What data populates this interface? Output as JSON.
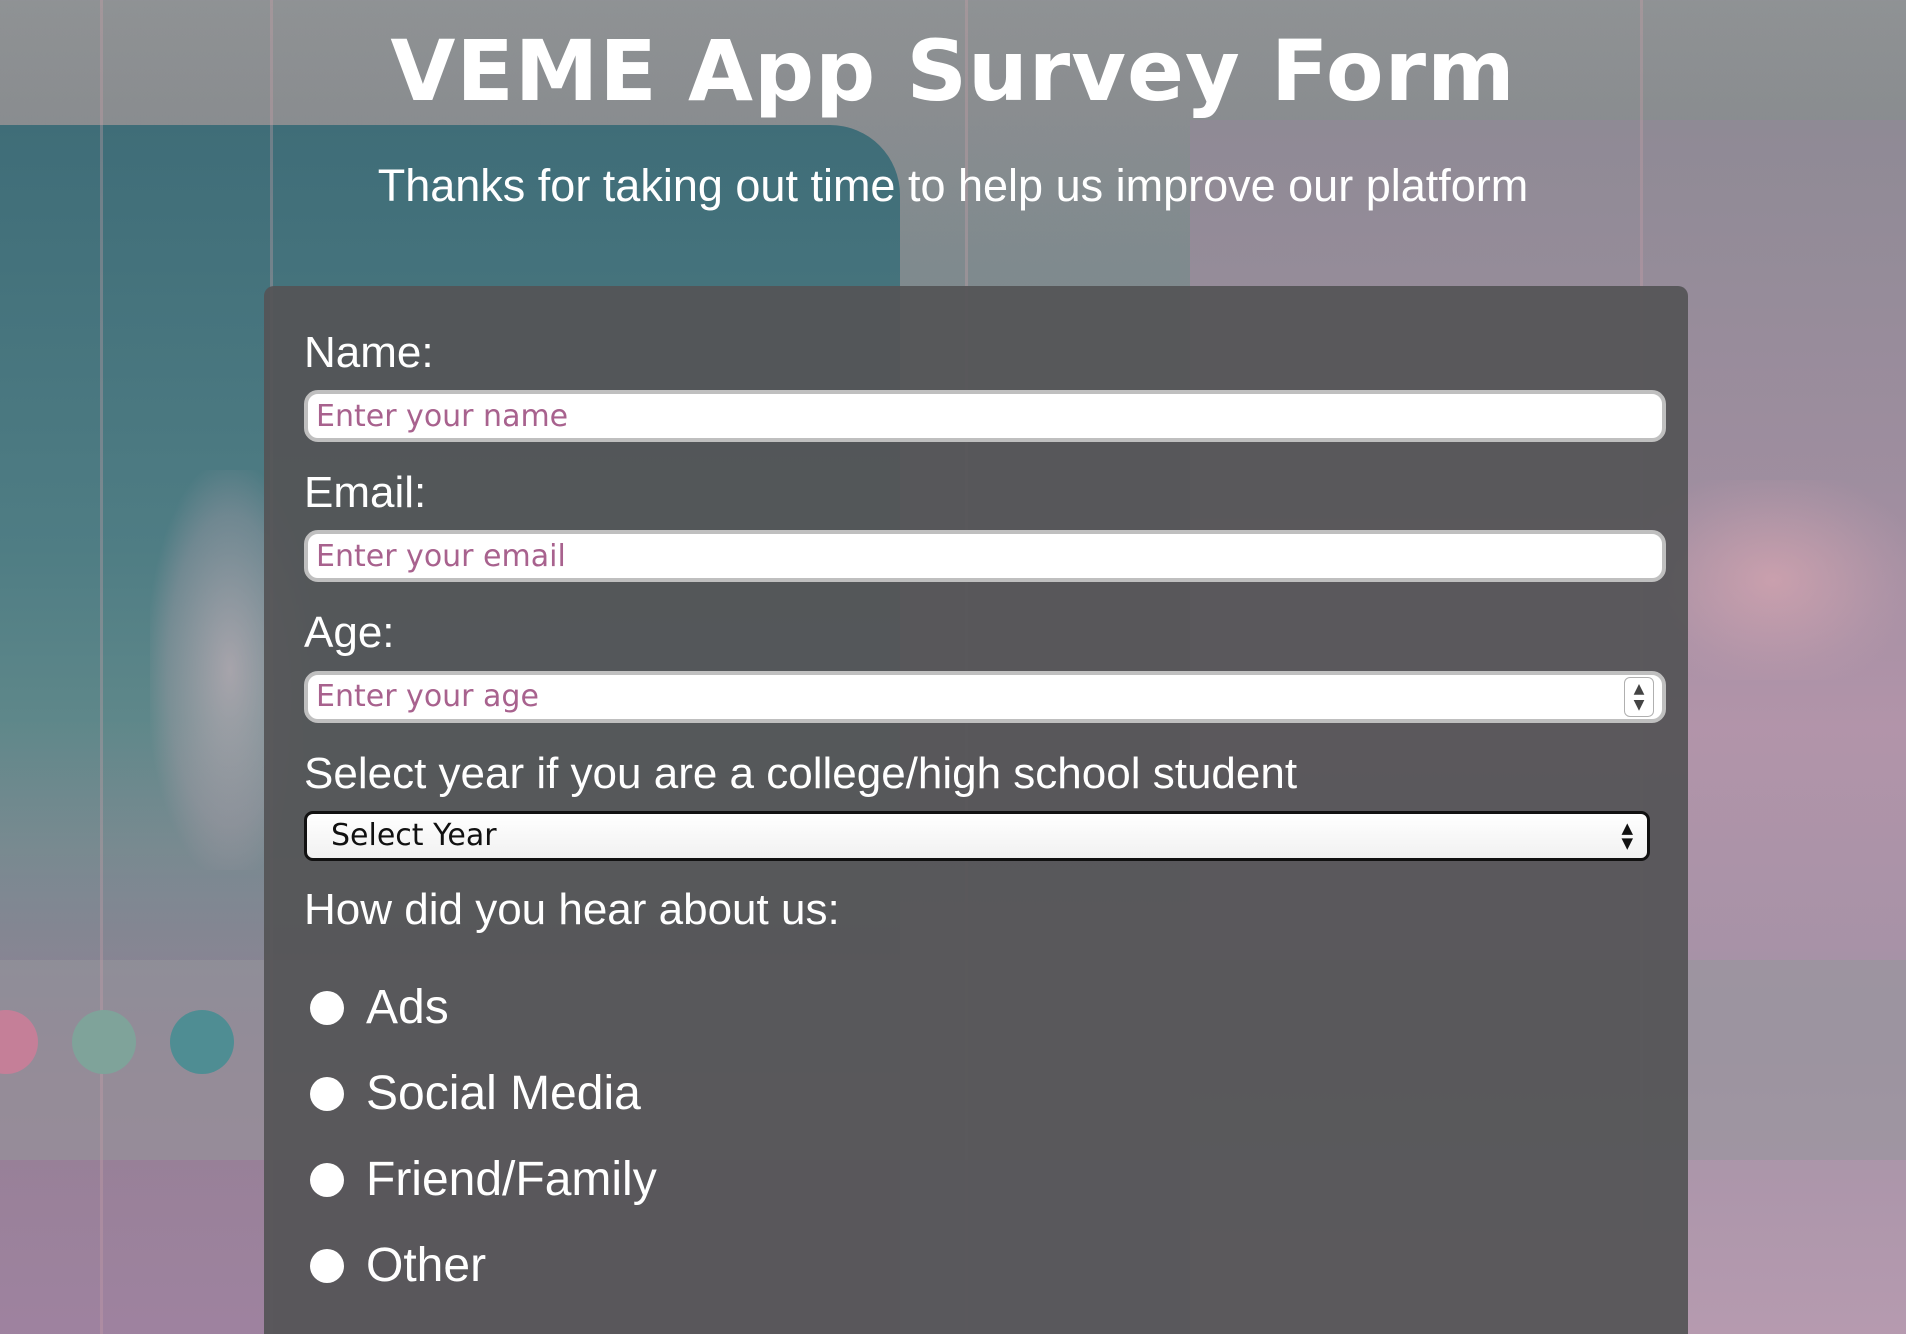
{
  "header": {
    "title": "VEME App Survey Form",
    "subtitle": "Thanks for taking out time to help us improve our platform"
  },
  "form": {
    "name": {
      "label": "Name:",
      "placeholder": "Enter your name"
    },
    "email": {
      "label": "Email:",
      "placeholder": "Enter your email"
    },
    "age": {
      "label": "Age:",
      "placeholder": "Enter your age",
      "stepper_icon": "spinner-arrows-icon"
    },
    "year": {
      "label": "Select year if you are a college/high school student",
      "selected": "Select Year",
      "dropdown_icon": "select-arrows-icon"
    },
    "referral": {
      "label": "How did you hear about us:",
      "options": [
        {
          "label": "Ads"
        },
        {
          "label": "Social Media"
        },
        {
          "label": "Friend/Family"
        },
        {
          "label": "Other"
        }
      ]
    }
  },
  "colors": {
    "card_background": "#545456",
    "placeholder_text": "#a8628e",
    "text": "#ffffff"
  }
}
